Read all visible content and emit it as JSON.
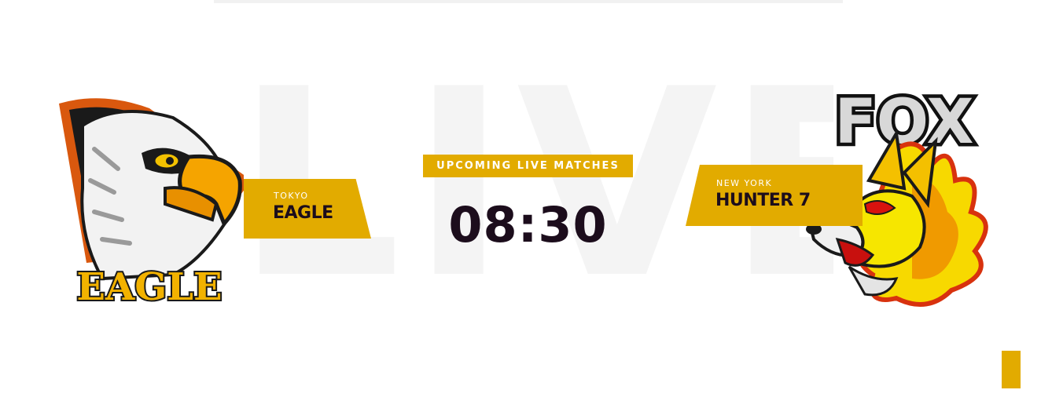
{
  "background_word": "LIVE",
  "center": {
    "label": "UPCOMING LIVE MATCHES",
    "time": "08:30"
  },
  "team_left": {
    "city": "TOKYO",
    "name": "EAGLE",
    "logo_text": "EAGLE",
    "logo_icon": "eagle-mascot"
  },
  "team_right": {
    "city": "NEW YORK",
    "name": "HUNTER 7",
    "logo_text": "FOX",
    "logo_icon": "fox-mascot"
  },
  "colors": {
    "accent": "#e2ab00",
    "dark": "#1c0d1c",
    "watermark": "#f4f4f4"
  }
}
